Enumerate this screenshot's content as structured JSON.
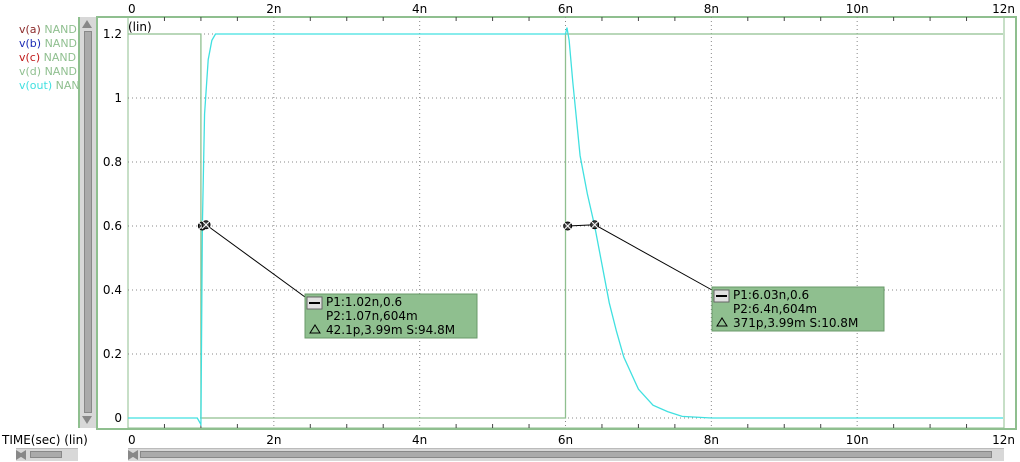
{
  "chart_data": {
    "type": "line",
    "y_scale_label": "(lin)",
    "xlabel": "TIME(sec) (lin)",
    "xlim": [
      0,
      12
    ],
    "ylim": [
      -0.05,
      1.25
    ],
    "x_ticks": [
      0,
      2,
      4,
      6,
      8,
      10,
      12
    ],
    "x_tick_labels": [
      "0",
      "2n",
      "4n",
      "6n",
      "8n",
      "10n",
      "12n"
    ],
    "y_ticks": [
      0,
      0.2,
      0.4,
      0.6,
      0.8,
      1.0,
      1.2
    ],
    "y_tick_labels": [
      "0",
      "0.2",
      "0.4",
      "0.6",
      "0.8",
      "1",
      "1.2"
    ],
    "grid": "dotted",
    "series": [
      {
        "name": "v(a)",
        "source": "NAND",
        "color": "#8b2a2a"
      },
      {
        "name": "v(b)",
        "source": "NAND",
        "color": "#1c2bb5"
      },
      {
        "name": "v(c)",
        "source": "NAND",
        "color": "#c01818"
      },
      {
        "name": "v(d)",
        "source": "NAND",
        "color": "#8fbf8f",
        "x": [
          0,
          1.0,
          1.0,
          6.0,
          6.0,
          12
        ],
        "y": [
          1.2,
          1.2,
          0,
          0,
          1.2,
          1.2
        ]
      },
      {
        "name": "v(out)",
        "source": "NAND",
        "color": "#40e0e0",
        "x": [
          0,
          0.95,
          1.0,
          1.02,
          1.05,
          1.1,
          1.15,
          1.2,
          1.3,
          6.0,
          6.02,
          6.05,
          6.1,
          6.2,
          6.3,
          6.4,
          6.5,
          6.6,
          6.7,
          6.8,
          7.0,
          7.2,
          7.4,
          7.6,
          8.0,
          12
        ],
        "y": [
          0,
          0,
          -0.02,
          0.6,
          0.95,
          1.12,
          1.18,
          1.2,
          1.2,
          1.2,
          1.22,
          1.18,
          1.05,
          0.82,
          0.7,
          0.6,
          0.48,
          0.36,
          0.27,
          0.19,
          0.09,
          0.04,
          0.02,
          0.005,
          0,
          0
        ]
      }
    ],
    "annotations": [
      {
        "p1": "P1:1.02n,0.6",
        "p2": "P2:1.07n,604m",
        "delta": "42.1p,3.99m S:94.8M",
        "markers": [
          [
            1.02,
            0.6
          ],
          [
            1.07,
            0.604
          ]
        ]
      },
      {
        "p1": "P1:6.03n,0.6",
        "p2": "P2:6.4n,604m",
        "delta": "371p,3.99m S:10.8M",
        "markers": [
          [
            6.03,
            0.6
          ],
          [
            6.4,
            0.604
          ]
        ]
      }
    ]
  },
  "legend": [
    {
      "name": "v(a)",
      "source": "NAND"
    },
    {
      "name": "v(b)",
      "source": "NAND"
    },
    {
      "name": "v(c)",
      "source": "NAND"
    },
    {
      "name": "v(d)",
      "source": "NAND"
    },
    {
      "name": "v(out)",
      "source": "NAND"
    }
  ],
  "axis_title": "TIME(sec) (lin)",
  "colors": {
    "plot_border": "#8fbf8f",
    "annotation_bg": "#8fbf8f",
    "grid": "#888888"
  },
  "icons": [
    "cursor-marker-icon",
    "delta-icon",
    "scroll-arrow-icon"
  ]
}
